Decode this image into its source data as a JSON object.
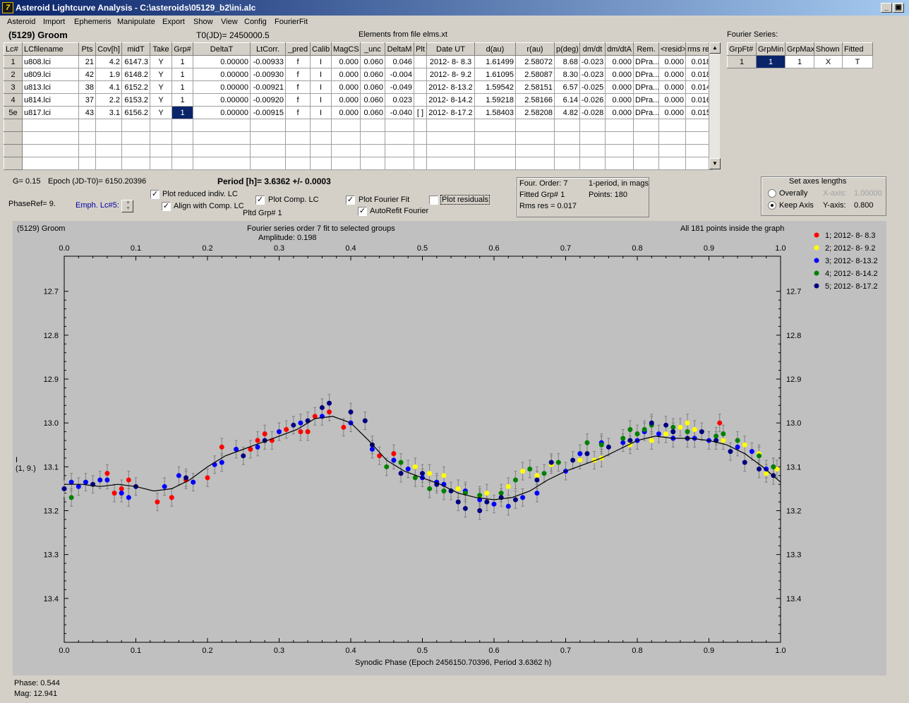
{
  "window": {
    "title": "Asteroid Lightcurve Analysis - C:\\asteroids\\05129_b2\\ini.alc",
    "app_icon_glyph": "7",
    "buttons": [
      "_",
      "▣",
      "×"
    ]
  },
  "menu": [
    "Asteroid",
    "Import",
    "Ephemeris",
    "Manipulate",
    "Export",
    "Show",
    "View",
    "Config",
    "FourierFit"
  ],
  "header": {
    "asteroid": "(5129) Groom",
    "t0": "T0(JD)= 2450000.5",
    "elements": "Elements from file elms.xt"
  },
  "lc_table": {
    "columns": [
      "Lc#",
      "LCfilename",
      "Pts",
      "Cov[h]",
      "midT",
      "Take",
      "Grp#",
      "DeltaT",
      "LtCorr.",
      "_pred",
      "Calib",
      "MagCS",
      "_unc",
      "DeltaM",
      "Plt",
      "Date UT",
      "d(au)",
      "r(au)",
      "p(deg)",
      "dm/dt",
      "dm/dtA",
      "Rem.",
      "<resid>",
      "rms res"
    ],
    "rows": [
      [
        "1",
        "u808.lci",
        "21",
        "4.2",
        "6147.3",
        "Y",
        "1",
        "0.00000",
        "-0.00933",
        "f",
        "I",
        "0.000",
        "0.060",
        "0.046",
        "",
        "2012- 8- 8.3",
        "1.61499",
        "2.58072",
        "8.68",
        "-0.023",
        "0.000",
        "DPra...",
        "0.000",
        "0.018"
      ],
      [
        "2",
        "u809.lci",
        "42",
        "1.9",
        "6148.2",
        "Y",
        "1",
        "0.00000",
        "-0.00930",
        "f",
        "I",
        "0.000",
        "0.060",
        "-0.004",
        "",
        "2012- 8- 9.2",
        "1.61095",
        "2.58087",
        "8.30",
        "-0.023",
        "0.000",
        "DPra...",
        "0.000",
        "0.018"
      ],
      [
        "3",
        "u813.lci",
        "38",
        "4.1",
        "6152.2",
        "Y",
        "1",
        "0.00000",
        "-0.00921",
        "f",
        "I",
        "0.000",
        "0.060",
        "-0.049",
        "",
        "2012- 8-13.2",
        "1.59542",
        "2.58151",
        "6.57",
        "-0.025",
        "0.000",
        "DPra...",
        "0.000",
        "0.014"
      ],
      [
        "4",
        "u814.lci",
        "37",
        "2.2",
        "6153.2",
        "Y",
        "1",
        "0.00000",
        "-0.00920",
        "f",
        "I",
        "0.000",
        "0.060",
        "0.023",
        "",
        "2012- 8-14.2",
        "1.59218",
        "2.58166",
        "6.14",
        "-0.026",
        "0.000",
        "DPra...",
        "0.000",
        "0.016"
      ],
      [
        "5e",
        "u817.lci",
        "43",
        "3.1",
        "6156.2",
        "Y",
        "1",
        "0.00000",
        "-0.00915",
        "f",
        "I",
        "0.000",
        "0.060",
        "-0.040",
        "[ ]",
        "2012- 8-17.2",
        "1.58403",
        "2.58208",
        "4.82",
        "-0.028",
        "0.000",
        "DPra...",
        "0.000",
        "0.015"
      ]
    ],
    "selected_cell": {
      "row": 4,
      "col": 6
    }
  },
  "fourier_panel": {
    "title": "Fourier Series:",
    "columns": [
      "GrpFt#",
      "GrpMin",
      "GrpMax",
      "Shown",
      "Fitted"
    ],
    "row": [
      "1",
      "1",
      "1",
      "X",
      "T"
    ]
  },
  "params": {
    "g": "G= 0.15",
    "epoch": "Epoch (JD-T0)= 6150.20396",
    "period": "Period [h]= 3.6362 +/- 0.0003",
    "phase_ref": "PhaseRef= 9.",
    "emph": "Emph. Lc#5:",
    "pltd_grp": "Pltd Grp#  1"
  },
  "checkboxes": [
    {
      "label": "Plot reduced indiv. LC",
      "checked": true
    },
    {
      "label": "Align with Comp. LC",
      "checked": true
    },
    {
      "label": "Plot Comp. LC",
      "checked": true
    },
    {
      "label": "Plot Fourier Fit",
      "checked": true
    },
    {
      "label": "AutoRefit Fourier",
      "checked": true
    },
    {
      "label": "Plot residuals",
      "checked": false
    }
  ],
  "fourier_info": {
    "order": "Four. Order:  7",
    "mode": "1-period, in mags",
    "fitted": "Fitted Grp# 1",
    "points": "Points: 180",
    "rms": "Rms res     = 0.017"
  },
  "axes_panel": {
    "title": "Set axes lengths",
    "overall": "Overally",
    "keep": "Keep Axis",
    "xaxis_label": "X-axis:",
    "xaxis_value": "1.00000",
    "yaxis_label": "Y-axis:",
    "yaxis_value": "0.800"
  },
  "graph": {
    "top_left": "(5129) Groom",
    "top_center": "Fourier series order 7 fit to selected groups",
    "amplitude": "Amplitude: 0.198",
    "top_right": "All 181 points inside the graph",
    "ylabel": "I",
    "ylabel2": "(1, 9.)"
  },
  "status": {
    "phase": "Phase:  0.544",
    "mag": "Mag:    12.941"
  },
  "chart_data": {
    "type": "scatter",
    "title": "Fourier series order 7 fit to selected groups",
    "xlabel": "Synodic Phase (Epoch 2456150.70396, Period 3.6362 h)",
    "ylabel": "I",
    "xlim": [
      0.0,
      1.0
    ],
    "ylim": [
      13.5,
      12.7
    ],
    "x_ticks": [
      "0.0",
      "0.1",
      "0.2",
      "0.3",
      "0.4",
      "0.5",
      "0.6",
      "0.7",
      "0.8",
      "0.9",
      "1.0"
    ],
    "y_ticks": [
      "12.7",
      "12.8",
      "12.9",
      "13.0",
      "13.1",
      "13.2",
      "13.3",
      "13.4"
    ],
    "legend_position": "right",
    "series": [
      {
        "name": "1; 2012- 8- 8.3",
        "color": "#ff0000",
        "points": [
          [
            0.06,
            13.115
          ],
          [
            0.07,
            13.16
          ],
          [
            0.08,
            13.15
          ],
          [
            0.09,
            13.13
          ],
          [
            0.13,
            13.18
          ],
          [
            0.15,
            13.17
          ],
          [
            0.17,
            13.13
          ],
          [
            0.2,
            13.125
          ],
          [
            0.22,
            13.055
          ],
          [
            0.26,
            13.06
          ],
          [
            0.27,
            13.04
          ],
          [
            0.28,
            13.025
          ],
          [
            0.29,
            13.04
          ],
          [
            0.3,
            13.02
          ],
          [
            0.31,
            13.015
          ],
          [
            0.33,
            13.02
          ],
          [
            0.34,
            13.02
          ],
          [
            0.35,
            12.985
          ],
          [
            0.37,
            12.975
          ],
          [
            0.39,
            13.01
          ],
          [
            0.44,
            13.075
          ],
          [
            0.46,
            13.07
          ],
          [
            0.915,
            13.0
          ]
        ]
      },
      {
        "name": "2; 2012- 8- 9.2",
        "color": "#ffff00",
        "points": [
          [
            0.49,
            13.1
          ],
          [
            0.51,
            13.115
          ],
          [
            0.53,
            13.12
          ],
          [
            0.55,
            13.15
          ],
          [
            0.58,
            13.17
          ],
          [
            0.59,
            13.16
          ],
          [
            0.62,
            13.145
          ],
          [
            0.64,
            13.11
          ],
          [
            0.66,
            13.12
          ],
          [
            0.68,
            13.095
          ],
          [
            0.72,
            13.085
          ],
          [
            0.74,
            13.085
          ],
          [
            0.75,
            13.08
          ],
          [
            0.79,
            13.05
          ],
          [
            0.82,
            13.04
          ],
          [
            0.84,
            13.025
          ],
          [
            0.86,
            13.01
          ],
          [
            0.87,
            13.0
          ],
          [
            0.88,
            13.015
          ],
          [
            0.9,
            13.04
          ],
          [
            0.92,
            13.04
          ],
          [
            0.95,
            13.05
          ],
          [
            0.97,
            13.07
          ],
          [
            0.98,
            13.115
          ],
          [
            0.995,
            13.105
          ]
        ]
      },
      {
        "name": "3; 2012- 8-13.2",
        "color": "#0000ff",
        "points": [
          [
            0.0,
            13.15
          ],
          [
            0.01,
            13.135
          ],
          [
            0.02,
            13.145
          ],
          [
            0.03,
            13.135
          ],
          [
            0.05,
            13.13
          ],
          [
            0.06,
            13.13
          ],
          [
            0.08,
            13.16
          ],
          [
            0.09,
            13.17
          ],
          [
            0.14,
            13.145
          ],
          [
            0.16,
            13.12
          ],
          [
            0.18,
            13.135
          ],
          [
            0.21,
            13.095
          ],
          [
            0.22,
            13.09
          ],
          [
            0.24,
            13.06
          ],
          [
            0.27,
            13.055
          ],
          [
            0.3,
            13.02
          ],
          [
            0.33,
            13.0
          ],
          [
            0.36,
            12.985
          ],
          [
            0.4,
            13.0
          ],
          [
            0.43,
            13.06
          ],
          [
            0.46,
            13.085
          ],
          [
            0.48,
            13.105
          ],
          [
            0.5,
            13.125
          ],
          [
            0.52,
            13.135
          ],
          [
            0.53,
            13.14
          ],
          [
            0.56,
            13.155
          ],
          [
            0.58,
            13.175
          ],
          [
            0.6,
            13.185
          ],
          [
            0.62,
            13.19
          ],
          [
            0.64,
            13.17
          ],
          [
            0.66,
            13.16
          ],
          [
            0.7,
            13.11
          ],
          [
            0.72,
            13.07
          ],
          [
            0.75,
            13.045
          ],
          [
            0.78,
            13.045
          ],
          [
            0.8,
            13.04
          ],
          [
            0.81,
            13.02
          ],
          [
            0.83,
            13.025
          ],
          [
            0.85,
            13.035
          ],
          [
            0.88,
            13.035
          ],
          [
            0.9,
            13.04
          ],
          [
            0.94,
            13.055
          ],
          [
            0.96,
            13.065
          ],
          [
            0.98,
            13.105
          ],
          [
            0.99,
            13.1
          ]
        ]
      },
      {
        "name": "4; 2012- 8-14.2",
        "color": "#008000",
        "points": [
          [
            0.01,
            13.17
          ],
          [
            0.45,
            13.1
          ],
          [
            0.47,
            13.09
          ],
          [
            0.49,
            13.125
          ],
          [
            0.51,
            13.15
          ],
          [
            0.53,
            13.155
          ],
          [
            0.56,
            13.16
          ],
          [
            0.58,
            13.165
          ],
          [
            0.61,
            13.16
          ],
          [
            0.63,
            13.13
          ],
          [
            0.65,
            13.105
          ],
          [
            0.67,
            13.115
          ],
          [
            0.69,
            13.09
          ],
          [
            0.73,
            13.045
          ],
          [
            0.75,
            13.05
          ],
          [
            0.78,
            13.035
          ],
          [
            0.79,
            13.015
          ],
          [
            0.8,
            13.025
          ],
          [
            0.81,
            13.015
          ],
          [
            0.82,
            13.005
          ],
          [
            0.85,
            13.01
          ],
          [
            0.87,
            13.02
          ],
          [
            0.91,
            13.03
          ],
          [
            0.92,
            13.025
          ],
          [
            0.94,
            13.04
          ],
          [
            0.97,
            13.075
          ],
          [
            0.99,
            13.1
          ]
        ]
      },
      {
        "name": "5; 2012- 8-17.2",
        "color": "#000080",
        "points": [
          [
            0.0,
            13.15
          ],
          [
            0.04,
            13.14
          ],
          [
            0.1,
            13.145
          ],
          [
            0.17,
            13.125
          ],
          [
            0.25,
            13.075
          ],
          [
            0.28,
            13.04
          ],
          [
            0.32,
            13.005
          ],
          [
            0.34,
            12.995
          ],
          [
            0.36,
            12.965
          ],
          [
            0.37,
            12.955
          ],
          [
            0.4,
            12.975
          ],
          [
            0.42,
            12.995
          ],
          [
            0.43,
            13.05
          ],
          [
            0.47,
            13.115
          ],
          [
            0.5,
            13.115
          ],
          [
            0.52,
            13.14
          ],
          [
            0.54,
            13.155
          ],
          [
            0.55,
            13.18
          ],
          [
            0.56,
            13.195
          ],
          [
            0.58,
            13.2
          ],
          [
            0.59,
            13.18
          ],
          [
            0.61,
            13.17
          ],
          [
            0.63,
            13.175
          ],
          [
            0.66,
            13.13
          ],
          [
            0.68,
            13.09
          ],
          [
            0.71,
            13.085
          ],
          [
            0.73,
            13.07
          ],
          [
            0.76,
            13.055
          ],
          [
            0.79,
            13.04
          ],
          [
            0.82,
            13.0
          ],
          [
            0.84,
            13.005
          ],
          [
            0.85,
            13.02
          ],
          [
            0.87,
            13.035
          ],
          [
            0.89,
            13.02
          ],
          [
            0.91,
            13.04
          ],
          [
            0.93,
            13.065
          ],
          [
            0.95,
            13.09
          ],
          [
            0.97,
            13.105
          ],
          [
            0.99,
            13.12
          ]
        ]
      }
    ],
    "fourier_fit": [
      [
        0.0,
        13.14
      ],
      [
        0.025,
        13.14
      ],
      [
        0.05,
        13.145
      ],
      [
        0.075,
        13.14
      ],
      [
        0.1,
        13.145
      ],
      [
        0.125,
        13.155
      ],
      [
        0.15,
        13.15
      ],
      [
        0.175,
        13.13
      ],
      [
        0.2,
        13.1
      ],
      [
        0.225,
        13.075
      ],
      [
        0.25,
        13.06
      ],
      [
        0.275,
        13.045
      ],
      [
        0.3,
        13.03
      ],
      [
        0.325,
        13.015
      ],
      [
        0.35,
        12.99
      ],
      [
        0.375,
        12.985
      ],
      [
        0.4,
        13.0
      ],
      [
        0.425,
        13.04
      ],
      [
        0.45,
        13.085
      ],
      [
        0.475,
        13.11
      ],
      [
        0.5,
        13.125
      ],
      [
        0.525,
        13.14
      ],
      [
        0.55,
        13.16
      ],
      [
        0.575,
        13.17
      ],
      [
        0.6,
        13.175
      ],
      [
        0.625,
        13.17
      ],
      [
        0.65,
        13.155
      ],
      [
        0.675,
        13.13
      ],
      [
        0.7,
        13.11
      ],
      [
        0.725,
        13.095
      ],
      [
        0.75,
        13.08
      ],
      [
        0.775,
        13.06
      ],
      [
        0.8,
        13.04
      ],
      [
        0.825,
        13.03
      ],
      [
        0.85,
        13.035
      ],
      [
        0.875,
        13.035
      ],
      [
        0.9,
        13.04
      ],
      [
        0.925,
        13.05
      ],
      [
        0.95,
        13.07
      ],
      [
        0.975,
        13.1
      ],
      [
        1.0,
        13.135
      ]
    ]
  }
}
